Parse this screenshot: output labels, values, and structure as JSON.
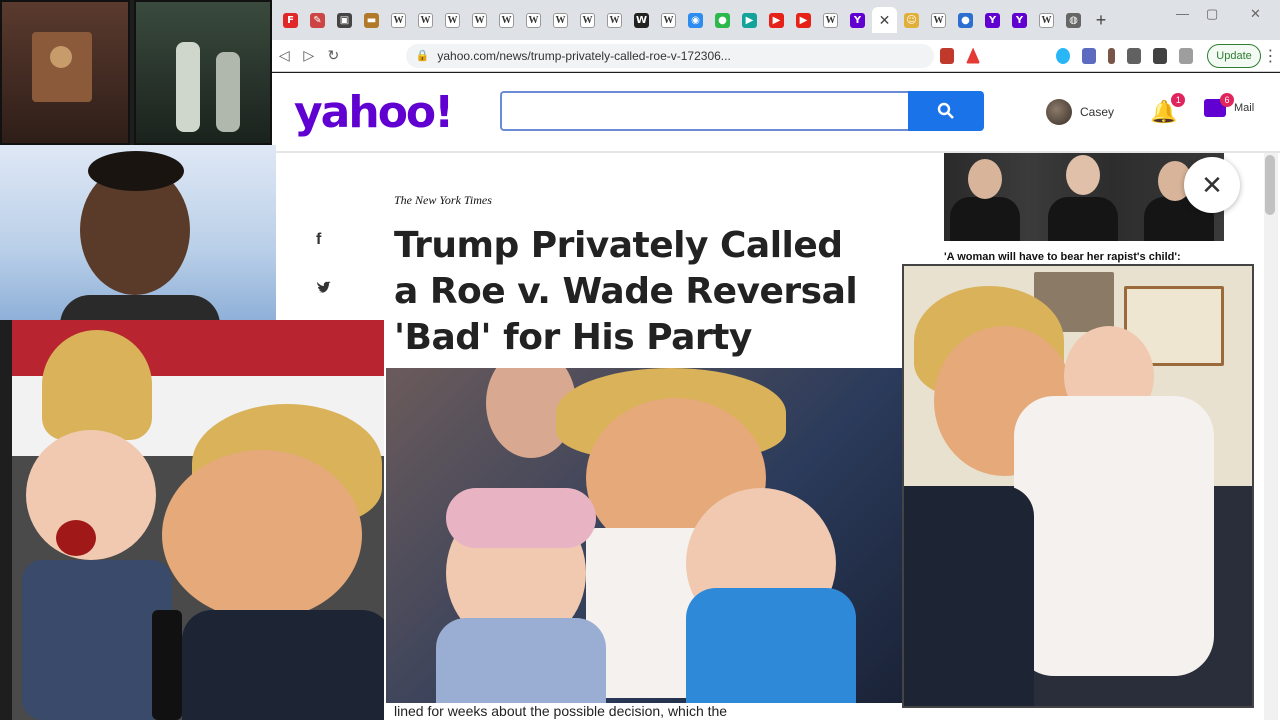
{
  "browser": {
    "tabs": [
      {
        "icon": "flipboard-icon",
        "glyph": "F",
        "color": "#e12828"
      },
      {
        "icon": "pin-icon",
        "glyph": "✎",
        "color": "#c44"
      },
      {
        "icon": "image-icon",
        "glyph": "▣",
        "color": "#444"
      },
      {
        "icon": "folder-icon",
        "glyph": "▬",
        "color": "#b07a2a"
      },
      {
        "icon": "wikipedia-icon",
        "glyph": "W",
        "color": "#fff"
      },
      {
        "icon": "wikipedia-icon",
        "glyph": "W",
        "color": "#fff"
      },
      {
        "icon": "wikipedia-icon",
        "glyph": "W",
        "color": "#fff"
      },
      {
        "icon": "wikipedia-icon",
        "glyph": "W",
        "color": "#fff"
      },
      {
        "icon": "wikipedia-icon",
        "glyph": "W",
        "color": "#fff"
      },
      {
        "icon": "wikipedia-icon",
        "glyph": "W",
        "color": "#fff"
      },
      {
        "icon": "wikipedia-icon",
        "glyph": "W",
        "color": "#fff"
      },
      {
        "icon": "wikipedia-icon",
        "glyph": "W",
        "color": "#fff"
      },
      {
        "icon": "wikipedia-icon",
        "glyph": "W",
        "color": "#fff"
      },
      {
        "icon": "wapo-icon",
        "glyph": "W",
        "color": "#222"
      },
      {
        "icon": "wikipedia-icon",
        "glyph": "W",
        "color": "#fff"
      },
      {
        "icon": "circle-blue-icon",
        "glyph": "◉",
        "color": "#2d8cf0"
      },
      {
        "icon": "circle-green-icon",
        "glyph": "●",
        "color": "#2db84c"
      },
      {
        "icon": "play-teal-icon",
        "glyph": "▶",
        "color": "#14a39a"
      },
      {
        "icon": "youtube-icon",
        "glyph": "▶",
        "color": "#e62117"
      },
      {
        "icon": "youtube-icon",
        "glyph": "▶",
        "color": "#e62117"
      },
      {
        "icon": "wikipedia-icon",
        "glyph": "W",
        "color": "#fff"
      },
      {
        "icon": "yahoo-icon",
        "glyph": "Y",
        "color": "#6001d2"
      },
      {
        "icon": "close-icon",
        "glyph": "✕",
        "color": "#fff",
        "active": true
      },
      {
        "icon": "smile-icon",
        "glyph": "☺",
        "color": "#e0b03a"
      },
      {
        "icon": "wikipedia-icon",
        "glyph": "W",
        "color": "#fff"
      },
      {
        "icon": "drop-icon",
        "glyph": "●",
        "color": "#2c6fd1"
      },
      {
        "icon": "yahoo-icon",
        "glyph": "Y",
        "color": "#6001d2"
      },
      {
        "icon": "yahoo-icon",
        "glyph": "Y",
        "color": "#6001d2"
      },
      {
        "icon": "wikipedia-icon",
        "glyph": "W",
        "color": "#fff"
      },
      {
        "icon": "globe-icon",
        "glyph": "◍",
        "color": "#666"
      }
    ],
    "new_tab": "+",
    "window_controls": {
      "minimize": "—",
      "maximize": "▢",
      "close": "✕"
    },
    "url": "yahoo.com/news/trump-privately-called-roe-v-172306...",
    "update_label": "Update",
    "nav": {
      "back": "◁",
      "forward": "▷",
      "reload": "↻"
    }
  },
  "yahoo": {
    "logo": "yahoo!",
    "search_placeholder": "",
    "user_name": "Casey",
    "notification_count": "1",
    "mail_count": "6",
    "mail_label": "Mail",
    "brand_color": "#6001d2",
    "search_button_color": "#1a73e8"
  },
  "article": {
    "publisher": "The New York Times",
    "headline": "Trump Privately Called a Roe v. Wade Reversal 'Bad' for His Party",
    "snippet": "lined for weeks about the possible decision, which the",
    "share": {
      "facebook": "f",
      "twitter": "🐦"
    }
  },
  "rail": {
    "caption": "'A woman will have to bear her rapist's child':",
    "close": "✕"
  }
}
